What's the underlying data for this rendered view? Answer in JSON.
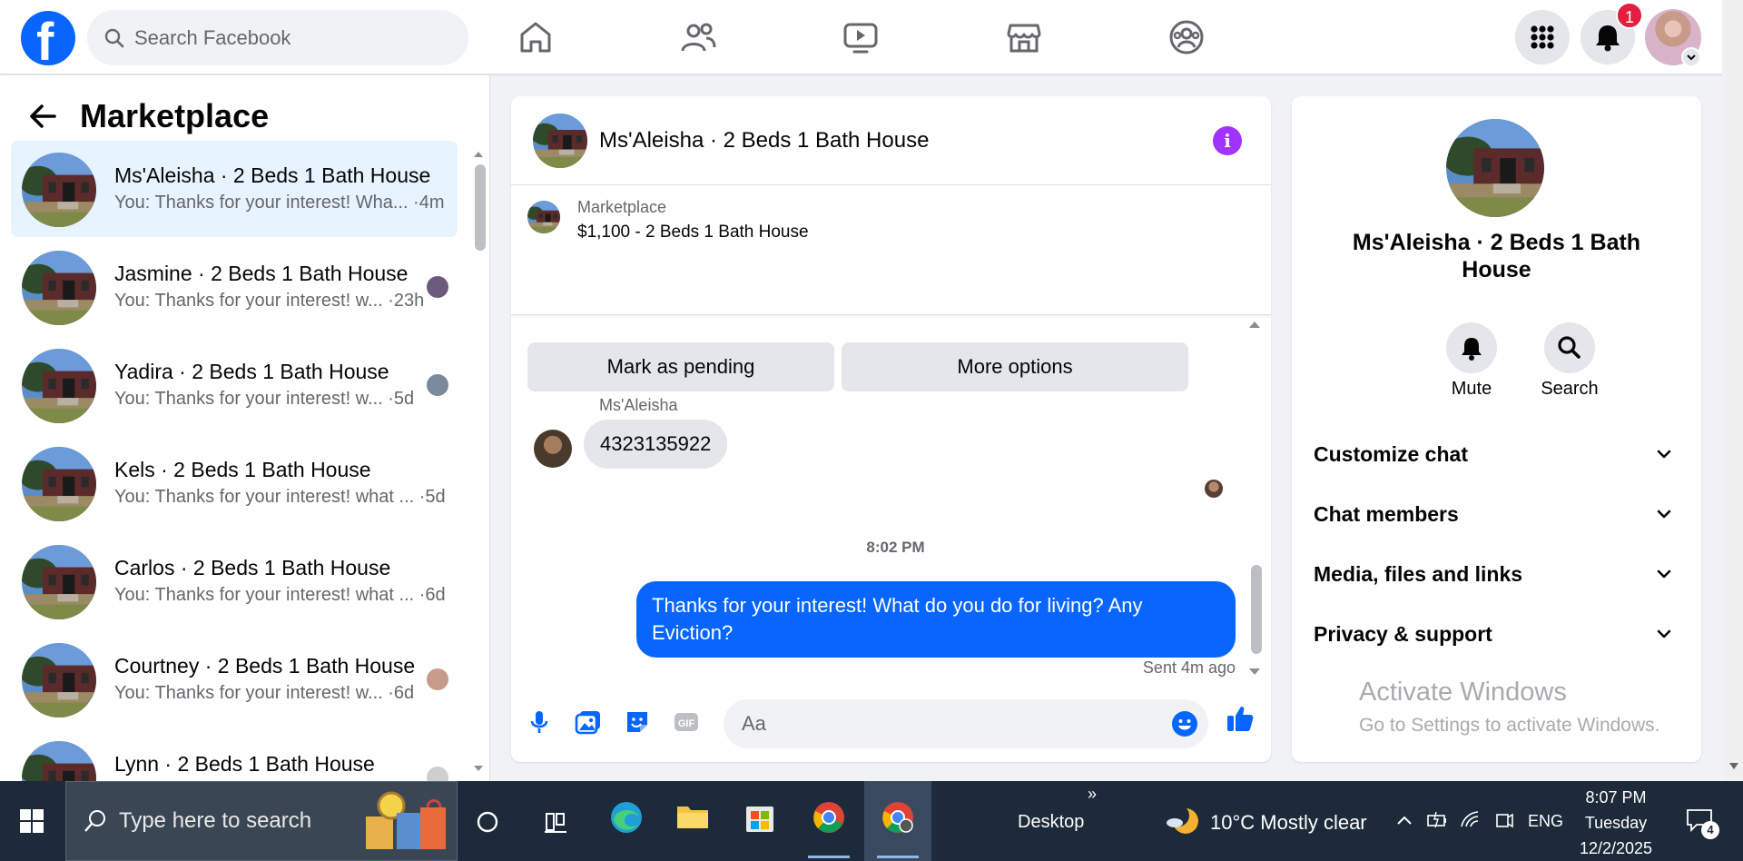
{
  "header": {
    "search_placeholder": "Search Facebook",
    "notification_count": "1",
    "nav": [
      "home-icon",
      "friends-icon",
      "video-icon",
      "marketplace-icon",
      "groups-icon"
    ],
    "accent": "#0866ff"
  },
  "left": {
    "title": "Marketplace",
    "conversations": [
      {
        "name": "Ms'Aleisha · 2 Beds 1 Bath House",
        "snippet": "You: Thanks for your interest! Wha... ·4m",
        "active": true
      },
      {
        "name": "Jasmine · 2 Beds 1 Bath House",
        "snippet": "You: Thanks for your interest! w... ·23h"
      },
      {
        "name": "Yadira · 2 Beds 1 Bath House",
        "snippet": "You: Thanks for your interest! w... ·5d"
      },
      {
        "name": "Kels · 2 Beds 1 Bath House",
        "snippet": "You: Thanks for your interest! what ... ·5d"
      },
      {
        "name": "Carlos · 2 Beds 1 Bath House",
        "snippet": "You: Thanks for your interest! what ... ·6d"
      },
      {
        "name": "Courtney · 2 Beds 1 Bath House",
        "snippet": "You: Thanks for your interest! w... ·6d"
      },
      {
        "name": "Lynn · 2 Beds 1 Bath House",
        "snippet": ""
      }
    ]
  },
  "chat": {
    "title": "Ms'Aleisha · 2 Beds 1 Bath House",
    "listing_category": "Marketplace",
    "listing_price": "$1,100 - 2 Beds 1 Bath House",
    "mark_pending": "Mark as pending",
    "more_options": "More options",
    "incoming_sender": "Ms'Aleisha",
    "incoming_message": "4323135922",
    "timestamp": "8:02 PM",
    "outgoing_message": "Thanks for your interest! What do you do for living? Any Eviction?",
    "sent_status": "Sent 4m ago",
    "composer_placeholder": "Aa"
  },
  "right": {
    "name": "Ms'Aleisha · 2 Beds 1 Bath House",
    "mute": "Mute",
    "search": "Search",
    "sections": [
      "Customize chat",
      "Chat members",
      "Media, files and links",
      "Privacy & support"
    ],
    "activate_title": "Activate Windows",
    "activate_sub": "Go to Settings to activate Windows."
  },
  "taskbar": {
    "search_placeholder": "Type here to search",
    "desktop": "Desktop",
    "weather": "10°C  Mostly clear",
    "lang": "ENG",
    "time": "8:07 PM",
    "day": "Tuesday",
    "date": "12/2/2025",
    "notif_count": "4"
  }
}
